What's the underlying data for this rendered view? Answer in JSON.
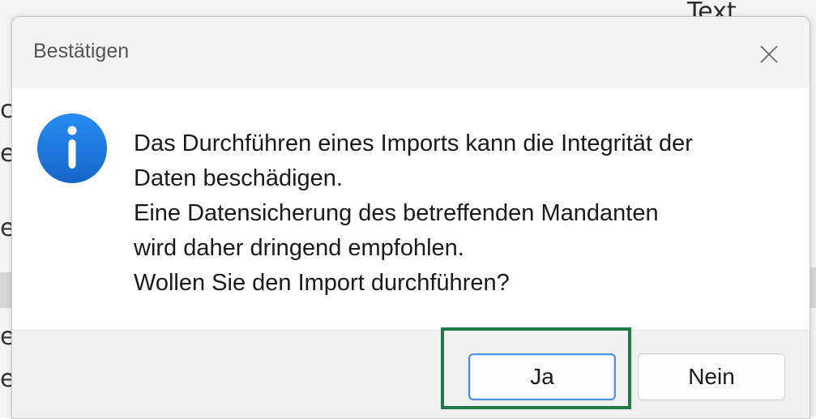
{
  "background": {
    "right_text": "Text",
    "left_fragments": [
      "c",
      "er",
      "e",
      "er",
      "e"
    ]
  },
  "dialog": {
    "title": "Bestätigen",
    "close_icon": "close-icon",
    "info_icon": "info-icon",
    "message_lines": [
      "Das Durchführen eines Imports kann die Integrität der",
      "Daten beschädigen.",
      "Eine Datensicherung des betreffenden Mandanten",
      "wird daher dringend empfohlen.",
      "Wollen Sie den Import durchführen?"
    ],
    "buttons": {
      "yes_label": "Ja",
      "no_label": "Nein"
    }
  },
  "colors": {
    "info_icon_blue": "#1a73e8",
    "highlight_green": "#1e7a46",
    "default_button_border": "#4f8fe0"
  }
}
